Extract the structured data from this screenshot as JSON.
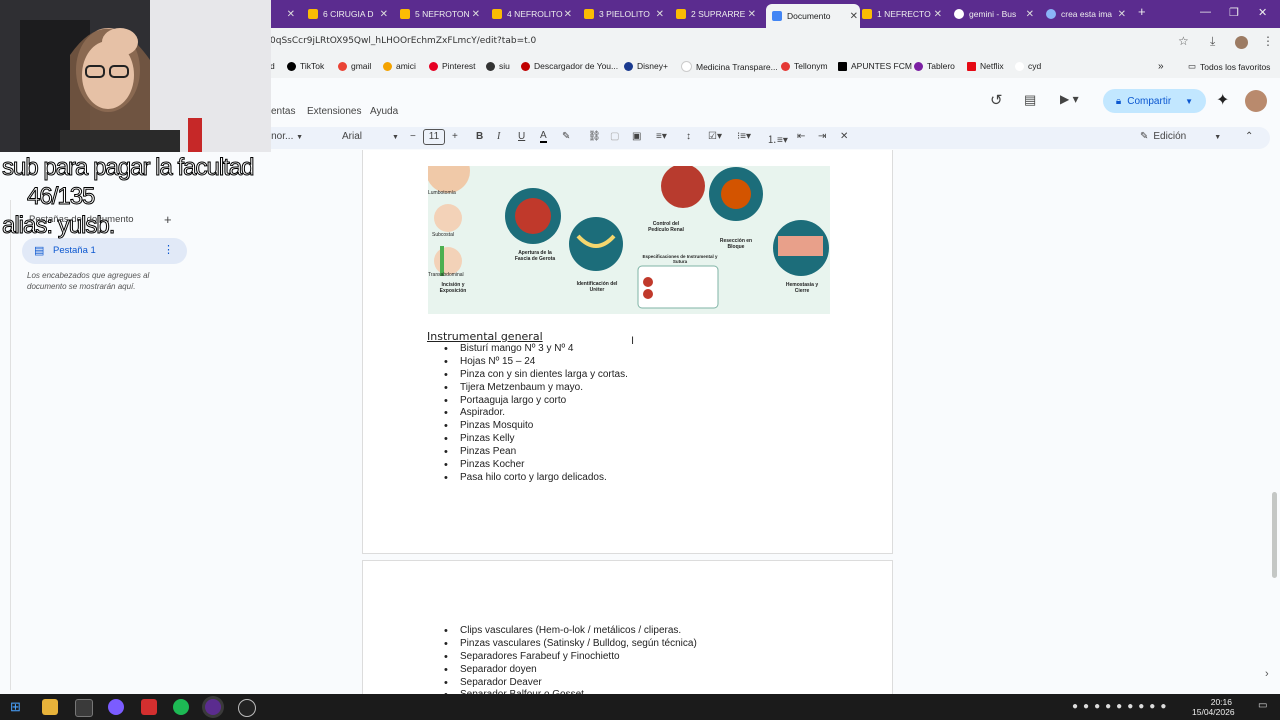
{
  "browser": {
    "tabs": [
      {
        "label": "6 CIRUGIA D",
        "color": "#fbbc04"
      },
      {
        "label": "5 NEFROTON",
        "color": "#fbbc04"
      },
      {
        "label": "4 NEFROLITO",
        "color": "#fbbc04"
      },
      {
        "label": "3 PIELOLITO",
        "color": "#fbbc04"
      },
      {
        "label": "2 SUPRARRE",
        "color": "#fbbc04"
      },
      {
        "label": "Documento",
        "color": "#4285f4"
      },
      {
        "label": "1 NEFRECTO",
        "color": "#fbbc04"
      },
      {
        "label": "gemini - Bus",
        "color": "#ffffff"
      },
      {
        "label": "crea esta ima",
        "color": "#8ab4f8"
      }
    ],
    "new_tab": "+",
    "url": "0qSsCcr9jLRtOX95Qwl_hLHOOrEchmZxFLmcY/edit?tab=t.0",
    "bookmarks": [
      {
        "label": "d",
        "color": "#5b2c8f"
      },
      {
        "label": "TikTok",
        "color": "#000000"
      },
      {
        "label": "gmail",
        "color": "#ea4335"
      },
      {
        "label": "amici",
        "color": "#f4a300"
      },
      {
        "label": "Pinterest",
        "color": "#e60023"
      },
      {
        "label": "siu",
        "color": "#333333"
      },
      {
        "label": "Descargador de You...",
        "color": "#c00000"
      },
      {
        "label": "Disney+",
        "color": "#1a3a8f"
      },
      {
        "label": "Medicina Transpare...",
        "color": "#ffffff"
      },
      {
        "label": "Tellonym",
        "color": "#e53935"
      },
      {
        "label": "APUNTES FCM",
        "color": "#000000"
      },
      {
        "label": "Tablero",
        "color": "#7b1fa2"
      },
      {
        "label": "Netflix",
        "color": "#e50914"
      },
      {
        "label": "cyd",
        "color": "#ffffff"
      }
    ],
    "all_bookmarks": "Todos los favoritos"
  },
  "docs": {
    "menus": [
      "entas",
      "Extensiones",
      "Ayuda"
    ],
    "share": "Compartir",
    "style_select": "to nor...",
    "font": "Arial",
    "font_size": "11",
    "mode": "Edición"
  },
  "sidebar": {
    "header": "Pestañas del documento",
    "tab_label": "Pestaña 1",
    "hint": "Los encabezados que agregues al documento se mostrarán aquí."
  },
  "overlay": {
    "line1": "sub para pagar la facultad",
    "line2": "46/135",
    "line3": "alias: yulsb."
  },
  "ruler": [
    "2",
    "1",
    "",
    "1",
    "2",
    "3",
    "4",
    "5",
    "6",
    "7",
    "8",
    "9",
    "10",
    "11",
    "12",
    "13",
    "14",
    "15",
    "16",
    "17",
    "18"
  ],
  "infographic": {
    "labels": [
      "Lumbotomía",
      "Subcostal",
      "Transabdominal",
      "Incisión y Exposición",
      "Apertura de la Fascia de Gerota",
      "Identificación del Uréter",
      "Control del Pedículo Renal",
      "Resección en Bloque",
      "Hemostasia y Cierre",
      "Especificaciones de Instrumental y Sutura"
    ]
  },
  "document": {
    "heading": "Instrumental general",
    "items1": [
      "Bisturí mango Nº 3 y Nº 4",
      "Hojas Nº 15 – 24",
      "Pinza con y sin dientes larga y cortas.",
      "Tijera Metzenbaum y mayo.",
      "Portaaguja largo y corto",
      "Aspirador.",
      "Pinzas Mosquito",
      "Pinzas Kelly",
      "Pinzas Pean",
      "Pinzas Kocher",
      "Pasa hilo corto y largo delicados."
    ],
    "items2": [
      "Clips vasculares (Hem-o-lok / metálicos / cliperas.",
      "Pinzas vasculares (Satinsky / Bulldog, según técnica)",
      "Separadores Farabeuf y Finochietto",
      "Separador doyen",
      "Separador Deaver",
      "Separador Balfour o Gosset"
    ]
  },
  "system": {
    "time": "20:16",
    "date": "15/04/2026"
  }
}
